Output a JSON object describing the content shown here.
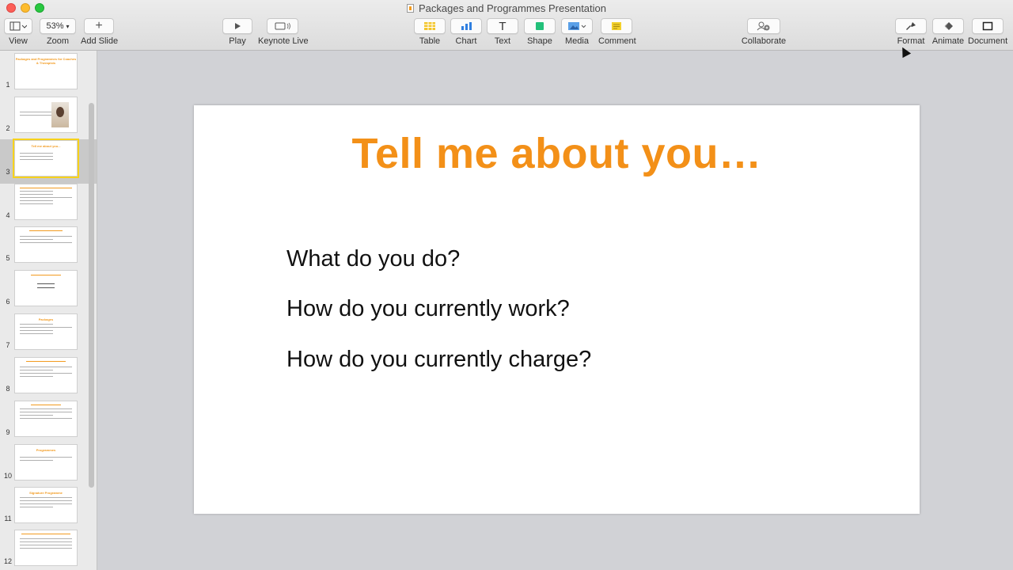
{
  "window": {
    "title": "Packages and Programmes Presentation"
  },
  "toolbar": {
    "view_label": "View",
    "zoom_label": "Zoom",
    "zoom_value": "53%",
    "add_slide_label": "Add Slide",
    "play_label": "Play",
    "keynote_live_label": "Keynote Live",
    "table_label": "Table",
    "chart_label": "Chart",
    "text_label": "Text",
    "shape_label": "Shape",
    "media_label": "Media",
    "comment_label": "Comment",
    "collaborate_label": "Collaborate",
    "format_label": "Format",
    "animate_label": "Animate",
    "document_label": "Document"
  },
  "sidebar": {
    "slides": [
      {
        "num": "1",
        "title": "Packages and Programmes for Coaches & Therapists"
      },
      {
        "num": "2",
        "title": ""
      },
      {
        "num": "3",
        "title": "Tell me about you..."
      },
      {
        "num": "4",
        "title": ""
      },
      {
        "num": "5",
        "title": ""
      },
      {
        "num": "6",
        "title": ""
      },
      {
        "num": "7",
        "title": "Packages"
      },
      {
        "num": "8",
        "title": ""
      },
      {
        "num": "9",
        "title": ""
      },
      {
        "num": "10",
        "title": "Programmes"
      },
      {
        "num": "11",
        "title": "Signature Programme"
      },
      {
        "num": "12",
        "title": ""
      }
    ]
  },
  "slide": {
    "title": "Tell me about you…",
    "bullets": [
      "What do you do?",
      "How do you currently work?",
      "How do you currently charge?"
    ]
  },
  "colors": {
    "accent": "#f39018",
    "selection": "#f7d21b"
  }
}
